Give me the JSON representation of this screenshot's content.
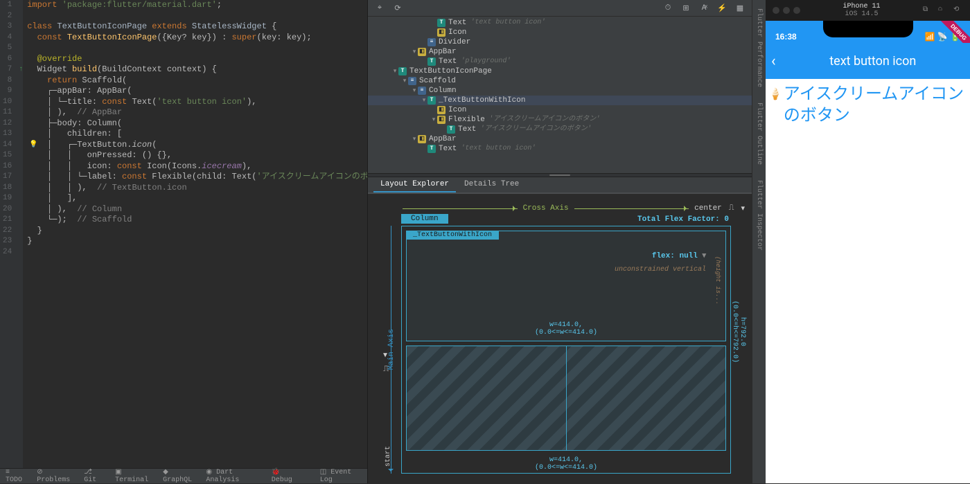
{
  "editor": {
    "lines": [
      {
        "n": 1,
        "html": "<span class='tok-kw'>import</span> <span class='tok-str'>'package:flutter/material.dart'</span>;"
      },
      {
        "n": 2,
        "html": ""
      },
      {
        "n": 3,
        "html": "<span class='tok-kw'>class</span> <span class='tok-class'>TextButtonIconPage</span> <span class='tok-kw'>extends</span> <span class='tok-class'>StatelessWidget</span> {"
      },
      {
        "n": 4,
        "html": "  <span class='tok-kw'>const</span> <span class='tok-fn'>TextButtonIconPage</span>({Key? key}) : <span class='tok-kw'>super</span>(key: key);"
      },
      {
        "n": 5,
        "html": ""
      },
      {
        "n": 6,
        "html": "  <span class='tok-ann'>@override</span>"
      },
      {
        "n": 7,
        "html": "  Widget <span class='tok-fn'>build</span>(BuildContext context) {"
      },
      {
        "n": 8,
        "html": "    <span class='tok-kw'>return</span> Scaffold("
      },
      {
        "n": 9,
        "html": "    ┌─appBar: AppBar("
      },
      {
        "n": 10,
        "html": "    │ └─title: <span class='tok-kw'>const</span> Text(<span class='tok-str'>'text button icon'</span>),"
      },
      {
        "n": 11,
        "html": "    │ ),  <span class='tok-comm'>// AppBar</span>"
      },
      {
        "n": 12,
        "html": "    ├─body: Column("
      },
      {
        "n": 13,
        "html": "    │   children: ["
      },
      {
        "n": 14,
        "html": "    │   ┌─TextButton.<span class='tok-it'>icon</span>("
      },
      {
        "n": 15,
        "html": "    │   │   onPressed: () {},"
      },
      {
        "n": 16,
        "html": "    │   │   icon: <span class='tok-kw'>const</span> Icon(Icons.<span class='tok-param'>icecream</span>),"
      },
      {
        "n": 17,
        "html": "    │   │ └─label: <span class='tok-kw'>const</span> Flexible(child: Text(<span class='tok-str'>'アイスクリームアイコンのボタン'</span>)),"
      },
      {
        "n": 18,
        "html": "    │   │ ),  <span class='tok-comm'>// TextButton.icon</span>"
      },
      {
        "n": 19,
        "html": "    │   ],"
      },
      {
        "n": 20,
        "html": "    │ ),  <span class='tok-comm'>// Column</span>"
      },
      {
        "n": 21,
        "html": "    └─);  <span class='tok-comm'>// Scaffold</span>"
      },
      {
        "n": 22,
        "html": "  }"
      },
      {
        "n": 23,
        "html": "}"
      },
      {
        "n": 24,
        "html": ""
      }
    ]
  },
  "tree": [
    {
      "d": 6,
      "twist": "",
      "b": "t",
      "label": "Text",
      "note": "'text button icon'"
    },
    {
      "d": 6,
      "twist": "",
      "b": "y",
      "label": "Icon",
      "note": ""
    },
    {
      "d": 5,
      "twist": "",
      "b": "b",
      "label": "Divider",
      "note": ""
    },
    {
      "d": 4,
      "twist": "▾",
      "b": "y",
      "label": "AppBar",
      "note": ""
    },
    {
      "d": 5,
      "twist": "",
      "b": "t",
      "label": "Text",
      "note": "'playground'"
    },
    {
      "d": 2,
      "twist": "▾",
      "b": "t",
      "label": "TextButtonIconPage",
      "note": ""
    },
    {
      "d": 3,
      "twist": "▾",
      "b": "b",
      "label": "Scaffold",
      "note": ""
    },
    {
      "d": 4,
      "twist": "▾",
      "b": "b",
      "label": "Column",
      "note": ""
    },
    {
      "d": 5,
      "twist": "▾",
      "b": "t",
      "label": "_TextButtonWithIcon",
      "note": "",
      "sel": true
    },
    {
      "d": 6,
      "twist": "",
      "b": "y",
      "label": "Icon",
      "note": ""
    },
    {
      "d": 6,
      "twist": "▾",
      "b": "y",
      "label": "Flexible",
      "note": "'アイスクリームアイコンのボタン'"
    },
    {
      "d": 7,
      "twist": "",
      "b": "t",
      "label": "Text",
      "note": "'アイスクリームアイコンのボタン'"
    },
    {
      "d": 4,
      "twist": "▾",
      "b": "y",
      "label": "AppBar",
      "note": ""
    },
    {
      "d": 5,
      "twist": "",
      "b": "t",
      "label": "Text",
      "note": "'text button icon'"
    }
  ],
  "tabs": {
    "layout": "Layout Explorer",
    "details": "Details Tree"
  },
  "axes": {
    "cross": "Cross Axis",
    "main": "Main Axis",
    "start": "start",
    "center": "center"
  },
  "layout": {
    "column": "Column",
    "flexFactor": "Total Flex Factor: 0",
    "child": "_TextButtonWithIcon",
    "flexnull": "flex: null",
    "uncon": "unconstrained vertical",
    "heightis": "(height is...",
    "wInner": "w=414.0,\n(0.0<=w<=414.0)",
    "wOuter": "w=414.0,\n(0.0<=w<=414.0)",
    "hOuter": "h=792.0\n(0.0<=h<=792.0)"
  },
  "sim": {
    "device": "iPhone 11",
    "os": "iOS 14.5",
    "time": "16:38",
    "appbar_title": "text button icon",
    "button_label": "アイスクリームアイコンのボタン"
  },
  "rails": {
    "perf": "Flutter Performance",
    "outline": "Flutter Outline",
    "insp": "Flutter Inspector"
  },
  "bottom": {
    "todo": "TODO",
    "problems": "Problems",
    "git": "Git",
    "terminal": "Terminal",
    "graphql": "GraphQL",
    "dart": "Dart Analysis",
    "debug": "Debug",
    "eventlog": "Event Log"
  }
}
